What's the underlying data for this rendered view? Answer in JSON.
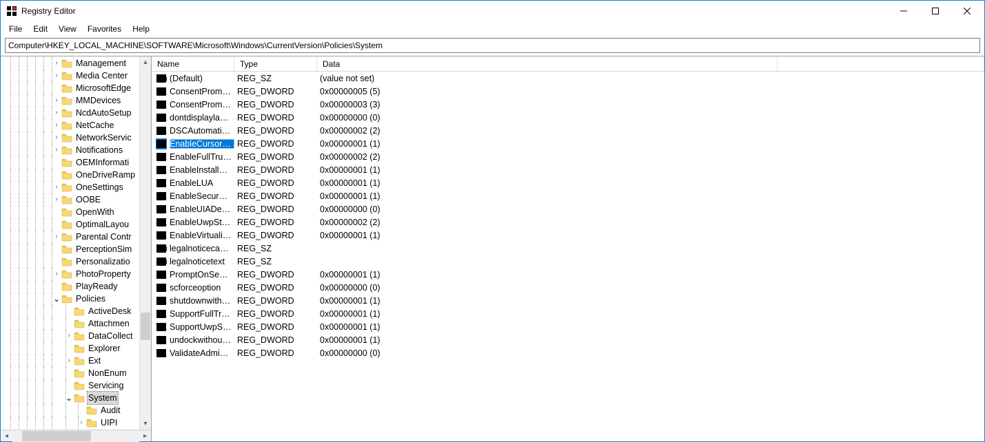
{
  "window": {
    "title": "Registry Editor"
  },
  "menu": {
    "file": "File",
    "edit": "Edit",
    "view": "View",
    "favorites": "Favorites",
    "help": "Help"
  },
  "address": "Computer\\HKEY_LOCAL_MACHINE\\SOFTWARE\\Microsoft\\Windows\\CurrentVersion\\Policies\\System",
  "columns": {
    "name": "Name",
    "type": "Type",
    "data": "Data"
  },
  "tree": [
    {
      "label": "Management",
      "depth": 0,
      "exp": ">"
    },
    {
      "label": "Media Center",
      "depth": 0,
      "exp": ">"
    },
    {
      "label": "MicrosoftEdge",
      "depth": 0,
      "exp": ""
    },
    {
      "label": "MMDevices",
      "depth": 0,
      "exp": ">"
    },
    {
      "label": "NcdAutoSetup",
      "depth": 0,
      "exp": ">"
    },
    {
      "label": "NetCache",
      "depth": 0,
      "exp": ">"
    },
    {
      "label": "NetworkServic",
      "depth": 0,
      "exp": ">"
    },
    {
      "label": "Notifications",
      "depth": 0,
      "exp": ">"
    },
    {
      "label": "OEMInformati",
      "depth": 0,
      "exp": ""
    },
    {
      "label": "OneDriveRamp",
      "depth": 0,
      "exp": ""
    },
    {
      "label": "OneSettings",
      "depth": 0,
      "exp": ">"
    },
    {
      "label": "OOBE",
      "depth": 0,
      "exp": ">"
    },
    {
      "label": "OpenWith",
      "depth": 0,
      "exp": ""
    },
    {
      "label": "OptimalLayou",
      "depth": 0,
      "exp": ""
    },
    {
      "label": "Parental Contr",
      "depth": 0,
      "exp": ">"
    },
    {
      "label": "PerceptionSim",
      "depth": 0,
      "exp": ""
    },
    {
      "label": "Personalizatio",
      "depth": 0,
      "exp": ""
    },
    {
      "label": "PhotoProperty",
      "depth": 0,
      "exp": ">"
    },
    {
      "label": "PlayReady",
      "depth": 0,
      "exp": ""
    },
    {
      "label": "Policies",
      "depth": 0,
      "exp": "v"
    },
    {
      "label": "ActiveDesk",
      "depth": 1,
      "exp": ""
    },
    {
      "label": "Attachmen",
      "depth": 1,
      "exp": ""
    },
    {
      "label": "DataCollect",
      "depth": 1,
      "exp": ">"
    },
    {
      "label": "Explorer",
      "depth": 1,
      "exp": ""
    },
    {
      "label": "Ext",
      "depth": 1,
      "exp": ">"
    },
    {
      "label": "NonEnum",
      "depth": 1,
      "exp": ""
    },
    {
      "label": "Servicing",
      "depth": 1,
      "exp": ""
    },
    {
      "label": "System",
      "depth": 1,
      "exp": "v",
      "selected": true
    },
    {
      "label": "Audit",
      "depth": 2,
      "exp": ""
    },
    {
      "label": "UIPI",
      "depth": 2,
      "exp": ">"
    }
  ],
  "values": [
    {
      "icon": "sz",
      "name": "(Default)",
      "type": "REG_SZ",
      "data": "(value not set)"
    },
    {
      "icon": "dw",
      "name": "ConsentPrompt...",
      "type": "REG_DWORD",
      "data": "0x00000005 (5)"
    },
    {
      "icon": "dw",
      "name": "ConsentPrompt...",
      "type": "REG_DWORD",
      "data": "0x00000003 (3)"
    },
    {
      "icon": "dw",
      "name": "dontdisplaylastu...",
      "type": "REG_DWORD",
      "data": "0x00000000 (0)"
    },
    {
      "icon": "dw",
      "name": "DSCAutomation...",
      "type": "REG_DWORD",
      "data": "0x00000002 (2)"
    },
    {
      "icon": "dw",
      "name": "EnableCursorSu...",
      "type": "REG_DWORD",
      "data": "0x00000001 (1)",
      "selected": true
    },
    {
      "icon": "dw",
      "name": "EnableFullTrustS...",
      "type": "REG_DWORD",
      "data": "0x00000002 (2)"
    },
    {
      "icon": "dw",
      "name": "EnableInstallerD...",
      "type": "REG_DWORD",
      "data": "0x00000001 (1)"
    },
    {
      "icon": "dw",
      "name": "EnableLUA",
      "type": "REG_DWORD",
      "data": "0x00000001 (1)"
    },
    {
      "icon": "dw",
      "name": "EnableSecureUI...",
      "type": "REG_DWORD",
      "data": "0x00000001 (1)"
    },
    {
      "icon": "dw",
      "name": "EnableUIADeskt...",
      "type": "REG_DWORD",
      "data": "0x00000000 (0)"
    },
    {
      "icon": "dw",
      "name": "EnableUwpStart...",
      "type": "REG_DWORD",
      "data": "0x00000002 (2)"
    },
    {
      "icon": "dw",
      "name": "EnableVirtualizat...",
      "type": "REG_DWORD",
      "data": "0x00000001 (1)"
    },
    {
      "icon": "sz",
      "name": "legalnoticecapti...",
      "type": "REG_SZ",
      "data": ""
    },
    {
      "icon": "sz",
      "name": "legalnoticetext",
      "type": "REG_SZ",
      "data": ""
    },
    {
      "icon": "dw",
      "name": "PromptOnSecur...",
      "type": "REG_DWORD",
      "data": "0x00000001 (1)"
    },
    {
      "icon": "dw",
      "name": "scforceoption",
      "type": "REG_DWORD",
      "data": "0x00000000 (0)"
    },
    {
      "icon": "dw",
      "name": "shutdownwitho...",
      "type": "REG_DWORD",
      "data": "0x00000001 (1)"
    },
    {
      "icon": "dw",
      "name": "SupportFullTrust...",
      "type": "REG_DWORD",
      "data": "0x00000001 (1)"
    },
    {
      "icon": "dw",
      "name": "SupportUwpStar...",
      "type": "REG_DWORD",
      "data": "0x00000001 (1)"
    },
    {
      "icon": "dw",
      "name": "undockwithoutl...",
      "type": "REG_DWORD",
      "data": "0x00000001 (1)"
    },
    {
      "icon": "dw",
      "name": "ValidateAdminC...",
      "type": "REG_DWORD",
      "data": "0x00000000 (0)"
    }
  ]
}
